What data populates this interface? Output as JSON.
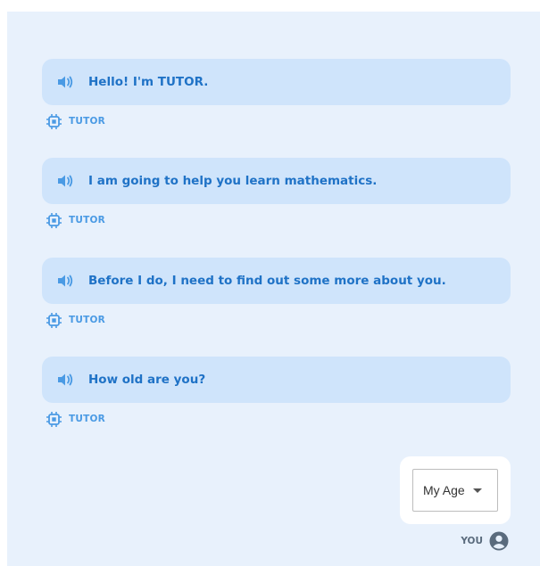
{
  "colors": {
    "panel_bg": "#e8f1fc",
    "bubble_bg": "#cfe4fb",
    "text_accent": "#1f72c6",
    "label_accent": "#4a9ae4",
    "you_color": "#5a6b7d"
  },
  "icons": {
    "message_icon": "speaker-icon",
    "sender_icon": "chip-icon",
    "user_icon": "user-circle-icon"
  },
  "conversation": {
    "messages": [
      {
        "text": "Hello! I'm TUTOR.",
        "sender": "TUTOR"
      },
      {
        "text": "I am going to help you learn mathematics.",
        "sender": "TUTOR"
      },
      {
        "text": "Before I do, I need to find out some more about you.",
        "sender": "TUTOR"
      },
      {
        "text": "How old are you?",
        "sender": "TUTOR"
      }
    ]
  },
  "reply": {
    "select_label": "My Age",
    "sender": "YOU"
  }
}
